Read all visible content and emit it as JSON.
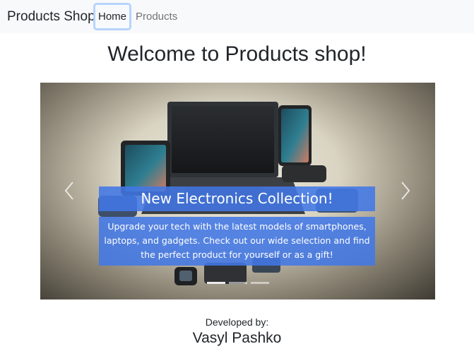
{
  "navbar": {
    "brand": "Products Shop",
    "items": [
      {
        "label": "Home",
        "active": true
      },
      {
        "label": "Products",
        "active": false
      }
    ]
  },
  "main": {
    "heading": "Welcome to Products shop!"
  },
  "carousel": {
    "slide": {
      "title": "New Electronics Collection!",
      "text": "Upgrade your tech with the latest models of smartphones, laptops, and gadgets. Check out our wide selection and find the perfect product for yourself or as a gift!"
    },
    "indicator_count": 3,
    "active_indicator": 0
  },
  "footer": {
    "label": "Developed by:",
    "author": "Vasyl Pashko"
  },
  "colors": {
    "navbar_bg": "#f8f9fa",
    "caption_bg": "#4278e6",
    "active_outline": "#b6d4fe"
  }
}
